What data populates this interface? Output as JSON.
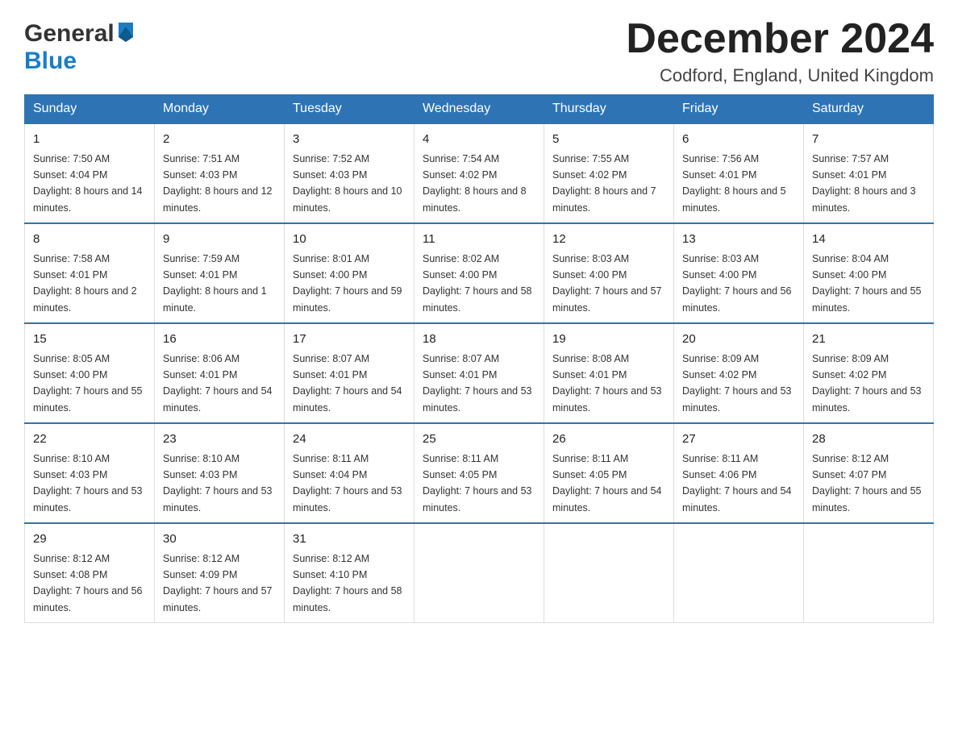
{
  "header": {
    "logo_general": "General",
    "logo_blue": "Blue",
    "title": "December 2024",
    "location": "Codford, England, United Kingdom"
  },
  "days_of_week": [
    "Sunday",
    "Monday",
    "Tuesday",
    "Wednesday",
    "Thursday",
    "Friday",
    "Saturday"
  ],
  "weeks": [
    [
      {
        "day": "1",
        "sunrise": "Sunrise: 7:50 AM",
        "sunset": "Sunset: 4:04 PM",
        "daylight": "Daylight: 8 hours and 14 minutes."
      },
      {
        "day": "2",
        "sunrise": "Sunrise: 7:51 AM",
        "sunset": "Sunset: 4:03 PM",
        "daylight": "Daylight: 8 hours and 12 minutes."
      },
      {
        "day": "3",
        "sunrise": "Sunrise: 7:52 AM",
        "sunset": "Sunset: 4:03 PM",
        "daylight": "Daylight: 8 hours and 10 minutes."
      },
      {
        "day": "4",
        "sunrise": "Sunrise: 7:54 AM",
        "sunset": "Sunset: 4:02 PM",
        "daylight": "Daylight: 8 hours and 8 minutes."
      },
      {
        "day": "5",
        "sunrise": "Sunrise: 7:55 AM",
        "sunset": "Sunset: 4:02 PM",
        "daylight": "Daylight: 8 hours and 7 minutes."
      },
      {
        "day": "6",
        "sunrise": "Sunrise: 7:56 AM",
        "sunset": "Sunset: 4:01 PM",
        "daylight": "Daylight: 8 hours and 5 minutes."
      },
      {
        "day": "7",
        "sunrise": "Sunrise: 7:57 AM",
        "sunset": "Sunset: 4:01 PM",
        "daylight": "Daylight: 8 hours and 3 minutes."
      }
    ],
    [
      {
        "day": "8",
        "sunrise": "Sunrise: 7:58 AM",
        "sunset": "Sunset: 4:01 PM",
        "daylight": "Daylight: 8 hours and 2 minutes."
      },
      {
        "day": "9",
        "sunrise": "Sunrise: 7:59 AM",
        "sunset": "Sunset: 4:01 PM",
        "daylight": "Daylight: 8 hours and 1 minute."
      },
      {
        "day": "10",
        "sunrise": "Sunrise: 8:01 AM",
        "sunset": "Sunset: 4:00 PM",
        "daylight": "Daylight: 7 hours and 59 minutes."
      },
      {
        "day": "11",
        "sunrise": "Sunrise: 8:02 AM",
        "sunset": "Sunset: 4:00 PM",
        "daylight": "Daylight: 7 hours and 58 minutes."
      },
      {
        "day": "12",
        "sunrise": "Sunrise: 8:03 AM",
        "sunset": "Sunset: 4:00 PM",
        "daylight": "Daylight: 7 hours and 57 minutes."
      },
      {
        "day": "13",
        "sunrise": "Sunrise: 8:03 AM",
        "sunset": "Sunset: 4:00 PM",
        "daylight": "Daylight: 7 hours and 56 minutes."
      },
      {
        "day": "14",
        "sunrise": "Sunrise: 8:04 AM",
        "sunset": "Sunset: 4:00 PM",
        "daylight": "Daylight: 7 hours and 55 minutes."
      }
    ],
    [
      {
        "day": "15",
        "sunrise": "Sunrise: 8:05 AM",
        "sunset": "Sunset: 4:00 PM",
        "daylight": "Daylight: 7 hours and 55 minutes."
      },
      {
        "day": "16",
        "sunrise": "Sunrise: 8:06 AM",
        "sunset": "Sunset: 4:01 PM",
        "daylight": "Daylight: 7 hours and 54 minutes."
      },
      {
        "day": "17",
        "sunrise": "Sunrise: 8:07 AM",
        "sunset": "Sunset: 4:01 PM",
        "daylight": "Daylight: 7 hours and 54 minutes."
      },
      {
        "day": "18",
        "sunrise": "Sunrise: 8:07 AM",
        "sunset": "Sunset: 4:01 PM",
        "daylight": "Daylight: 7 hours and 53 minutes."
      },
      {
        "day": "19",
        "sunrise": "Sunrise: 8:08 AM",
        "sunset": "Sunset: 4:01 PM",
        "daylight": "Daylight: 7 hours and 53 minutes."
      },
      {
        "day": "20",
        "sunrise": "Sunrise: 8:09 AM",
        "sunset": "Sunset: 4:02 PM",
        "daylight": "Daylight: 7 hours and 53 minutes."
      },
      {
        "day": "21",
        "sunrise": "Sunrise: 8:09 AM",
        "sunset": "Sunset: 4:02 PM",
        "daylight": "Daylight: 7 hours and 53 minutes."
      }
    ],
    [
      {
        "day": "22",
        "sunrise": "Sunrise: 8:10 AM",
        "sunset": "Sunset: 4:03 PM",
        "daylight": "Daylight: 7 hours and 53 minutes."
      },
      {
        "day": "23",
        "sunrise": "Sunrise: 8:10 AM",
        "sunset": "Sunset: 4:03 PM",
        "daylight": "Daylight: 7 hours and 53 minutes."
      },
      {
        "day": "24",
        "sunrise": "Sunrise: 8:11 AM",
        "sunset": "Sunset: 4:04 PM",
        "daylight": "Daylight: 7 hours and 53 minutes."
      },
      {
        "day": "25",
        "sunrise": "Sunrise: 8:11 AM",
        "sunset": "Sunset: 4:05 PM",
        "daylight": "Daylight: 7 hours and 53 minutes."
      },
      {
        "day": "26",
        "sunrise": "Sunrise: 8:11 AM",
        "sunset": "Sunset: 4:05 PM",
        "daylight": "Daylight: 7 hours and 54 minutes."
      },
      {
        "day": "27",
        "sunrise": "Sunrise: 8:11 AM",
        "sunset": "Sunset: 4:06 PM",
        "daylight": "Daylight: 7 hours and 54 minutes."
      },
      {
        "day": "28",
        "sunrise": "Sunrise: 8:12 AM",
        "sunset": "Sunset: 4:07 PM",
        "daylight": "Daylight: 7 hours and 55 minutes."
      }
    ],
    [
      {
        "day": "29",
        "sunrise": "Sunrise: 8:12 AM",
        "sunset": "Sunset: 4:08 PM",
        "daylight": "Daylight: 7 hours and 56 minutes."
      },
      {
        "day": "30",
        "sunrise": "Sunrise: 8:12 AM",
        "sunset": "Sunset: 4:09 PM",
        "daylight": "Daylight: 7 hours and 57 minutes."
      },
      {
        "day": "31",
        "sunrise": "Sunrise: 8:12 AM",
        "sunset": "Sunset: 4:10 PM",
        "daylight": "Daylight: 7 hours and 58 minutes."
      },
      null,
      null,
      null,
      null
    ]
  ]
}
